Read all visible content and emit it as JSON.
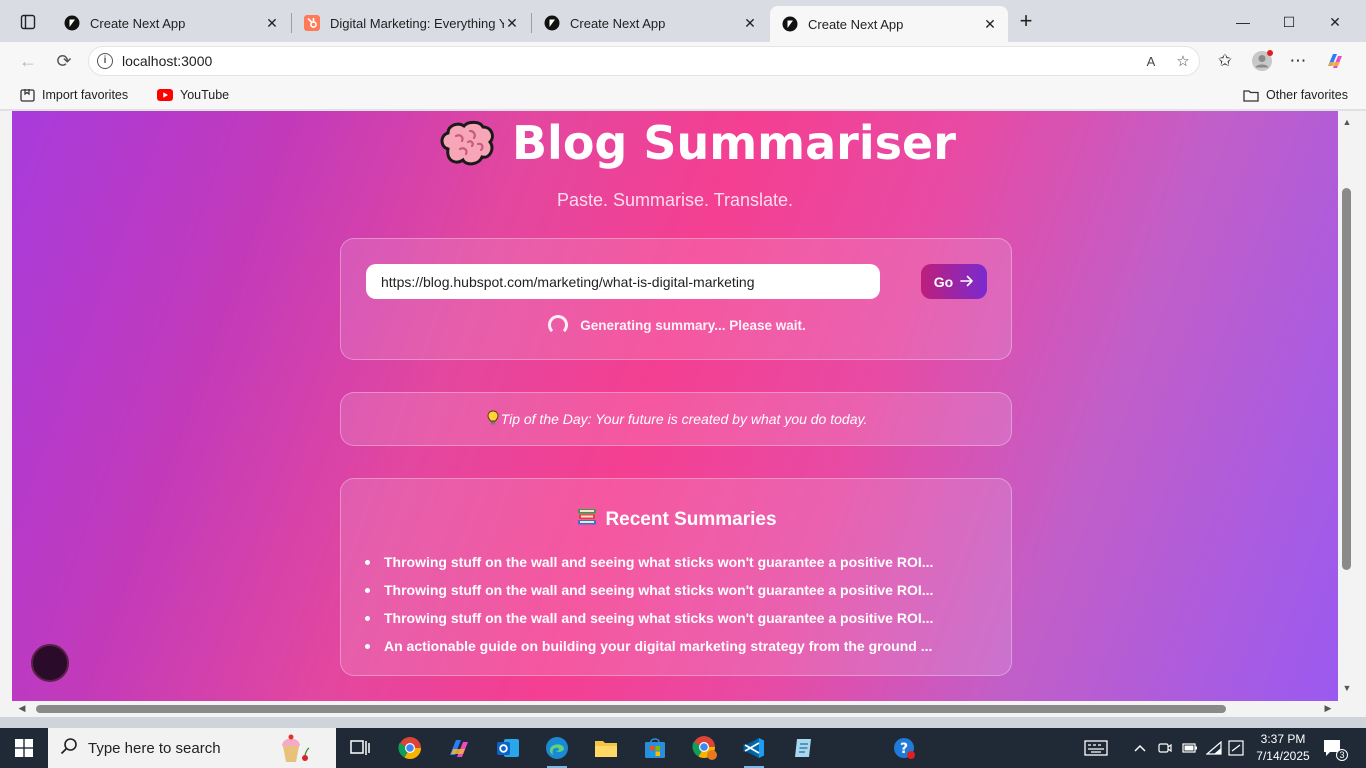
{
  "browser": {
    "tabs": [
      {
        "title": "Create Next App",
        "favicon": "nextjs-icon",
        "active": false
      },
      {
        "title": "Digital Marketing: Everything You",
        "favicon": "hubspot-icon",
        "active": false
      },
      {
        "title": "Create Next App",
        "favicon": "nextjs-icon",
        "active": false
      },
      {
        "title": "Create Next App",
        "favicon": "nextjs-icon",
        "active": true
      }
    ],
    "url": "localhost:3000",
    "bookmarks": {
      "import": "Import favorites",
      "youtube": "YouTube",
      "other": "Other favorites"
    }
  },
  "app": {
    "title": "Blog Summariser",
    "tagline": "Paste. Summarise. Translate.",
    "input_value": "https://blog.hubspot.com/marketing/what-is-digital-marketing",
    "go_label": "Go",
    "status": "Generating summary... Please wait.",
    "tip": "Tip of the Day: Your future is created by what you do today.",
    "recent_heading": "Recent Summaries",
    "recent": [
      "Throwing stuff on the wall and seeing what sticks won't guarantee a positive ROI...",
      "Throwing stuff on the wall and seeing what sticks won't guarantee a positive ROI...",
      "Throwing stuff on the wall and seeing what sticks won't guarantee a positive ROI...",
      "An actionable guide on building your digital marketing strategy from the ground ..."
    ]
  },
  "taskbar": {
    "search_placeholder": "Type here to search",
    "time": "3:37 PM",
    "date": "7/14/2025",
    "notification_count": "3"
  },
  "colors": {
    "gradient_start": "#a83bdc",
    "gradient_mid": "#f43f92",
    "gradient_end": "#9a5af0",
    "go_button_start": "#be1f7a",
    "go_button_end": "#7a2ad0"
  }
}
